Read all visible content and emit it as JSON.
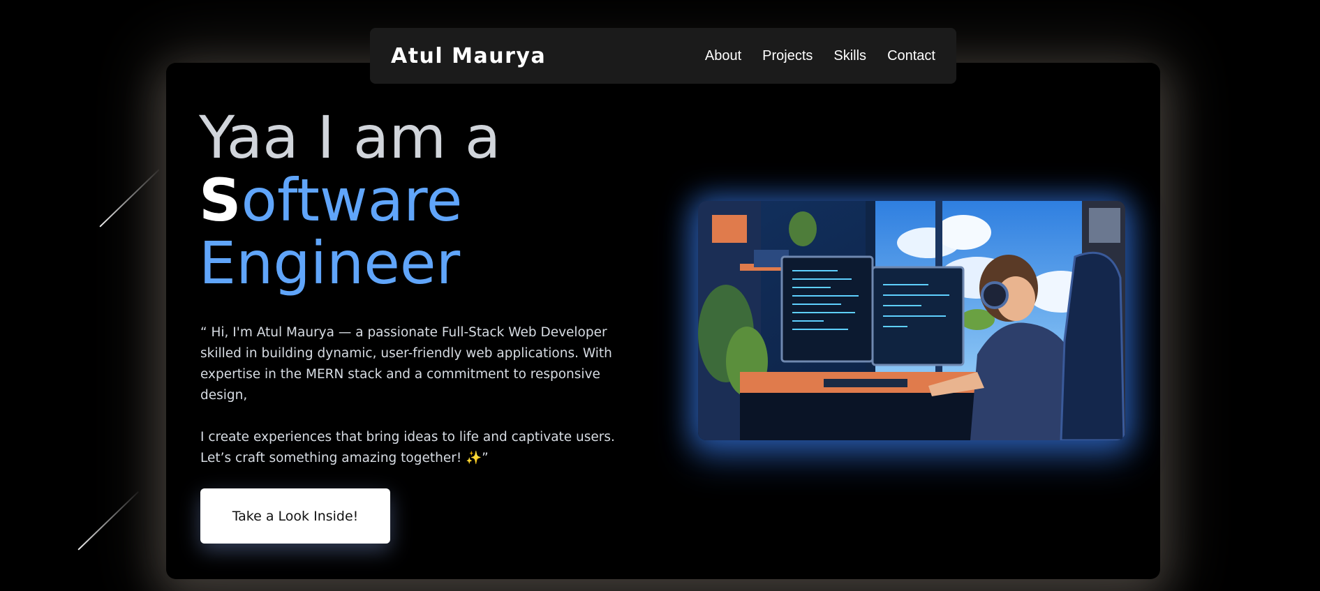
{
  "brand": "Atul Maurya",
  "nav": {
    "items": [
      "About",
      "Projects",
      "Skills",
      "Contact"
    ]
  },
  "hero": {
    "line1": "Yaa I am a",
    "line2_first_letter": "S",
    "line2_rest": "oftware",
    "line3": "Engineer",
    "paragraph1": "“ Hi, I'm Atul Maurya — a passionate Full-Stack Web Developer skilled in building dynamic, user-friendly web applications. With expertise in the MERN stack and a commitment to responsive design,",
    "paragraph2": "I create experiences that bring ideas to life and captivate users. Let’s craft something amazing together! ✨”",
    "cta_label": "Take a Look Inside!"
  },
  "colors": {
    "accent": "#60a5fa",
    "heading_gray": "#d1d5db",
    "navbar_bg": "#1b1b1b",
    "glow": "#3b82f6"
  }
}
